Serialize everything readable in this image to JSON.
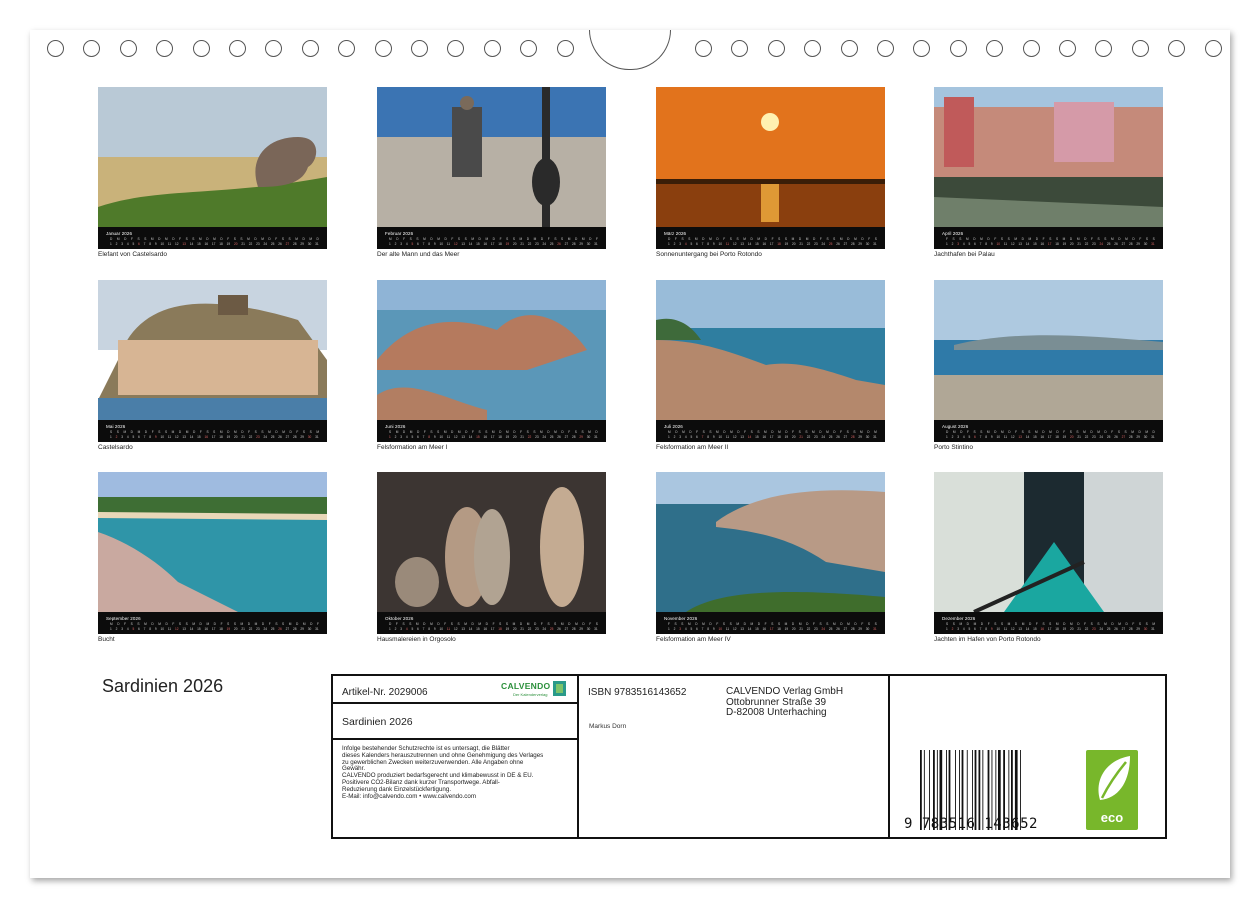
{
  "calendar": {
    "title": "Sardinien 2026",
    "months": [
      {
        "month": "Januar 2026",
        "caption": "Elefant von Castelsardo",
        "scene": "elephant"
      },
      {
        "month": "Februar 2026",
        "caption": "Der alte Mann und das Meer",
        "scene": "oldman"
      },
      {
        "month": "März 2026",
        "caption": "Sonnenuntergang bei Porto Rotondo",
        "scene": "sunset"
      },
      {
        "month": "April 2026",
        "caption": "Jachthafen bei Palau",
        "scene": "harbor"
      },
      {
        "month": "Mai 2026",
        "caption": "Castelsardo",
        "scene": "castle"
      },
      {
        "month": "Juni 2026",
        "caption": "Felsformation am Meer I",
        "scene": "rocks1"
      },
      {
        "month": "Juli 2026",
        "caption": "Felsformation am Meer II",
        "scene": "rocks2"
      },
      {
        "month": "August 2026",
        "caption": "Porto Stintino",
        "scene": "stintino"
      },
      {
        "month": "September 2026",
        "caption": "Bucht",
        "scene": "bay"
      },
      {
        "month": "Oktober 2026",
        "caption": "Hausmalereien in Orgosolo",
        "scene": "murals"
      },
      {
        "month": "November 2026",
        "caption": "Felsformation am Meer IV",
        "scene": "rocks4"
      },
      {
        "month": "Dezember 2026",
        "caption": "Jachten im Hafen von Porto Rotondo",
        "scene": "yachts"
      }
    ],
    "weekday_letters": [
      "M",
      "D",
      "M",
      "D",
      "F",
      "S",
      "S"
    ]
  },
  "info": {
    "article": "Artikel-Nr. 2029006",
    "title": "Sardinien 2026",
    "brand": "CALVENDO",
    "brand_sub": "Der Kalenderverlag",
    "legal_lines": [
      "Infolge bestehender Schutzrechte ist es untersagt, die Blätter",
      "dieses Kalenders herauszutrennen und ohne Genehmigung des Verlages",
      "zu gewerblichen Zwecken weiterzuverwenden. Alle Angaben ohne",
      "Gewähr.",
      "CALVENDO produziert bedarfsgerecht und klimabewusst in DE & EU.",
      "Positivere CO2-Bilanz dank kurzer Transportwege. Abfall-",
      "Reduzierung dank Einzelstückfertigung.",
      "E-Mail: info@calvendo.com • www.calvendo.com"
    ],
    "isbn": "ISBN 9783516143652",
    "publisher_lines": [
      "CALVENDO Verlag GmbH",
      "Ottobrunner Straße 39",
      "D-82008 Unterhaching"
    ],
    "author": "Markus Dorn",
    "barcode_number": "9 783516 143652",
    "eco_label": "eco"
  },
  "colors": {
    "calendar_bar": "#0c0c0c",
    "eco_green": "#78b72b",
    "brand_green": "#2a8f3a"
  }
}
